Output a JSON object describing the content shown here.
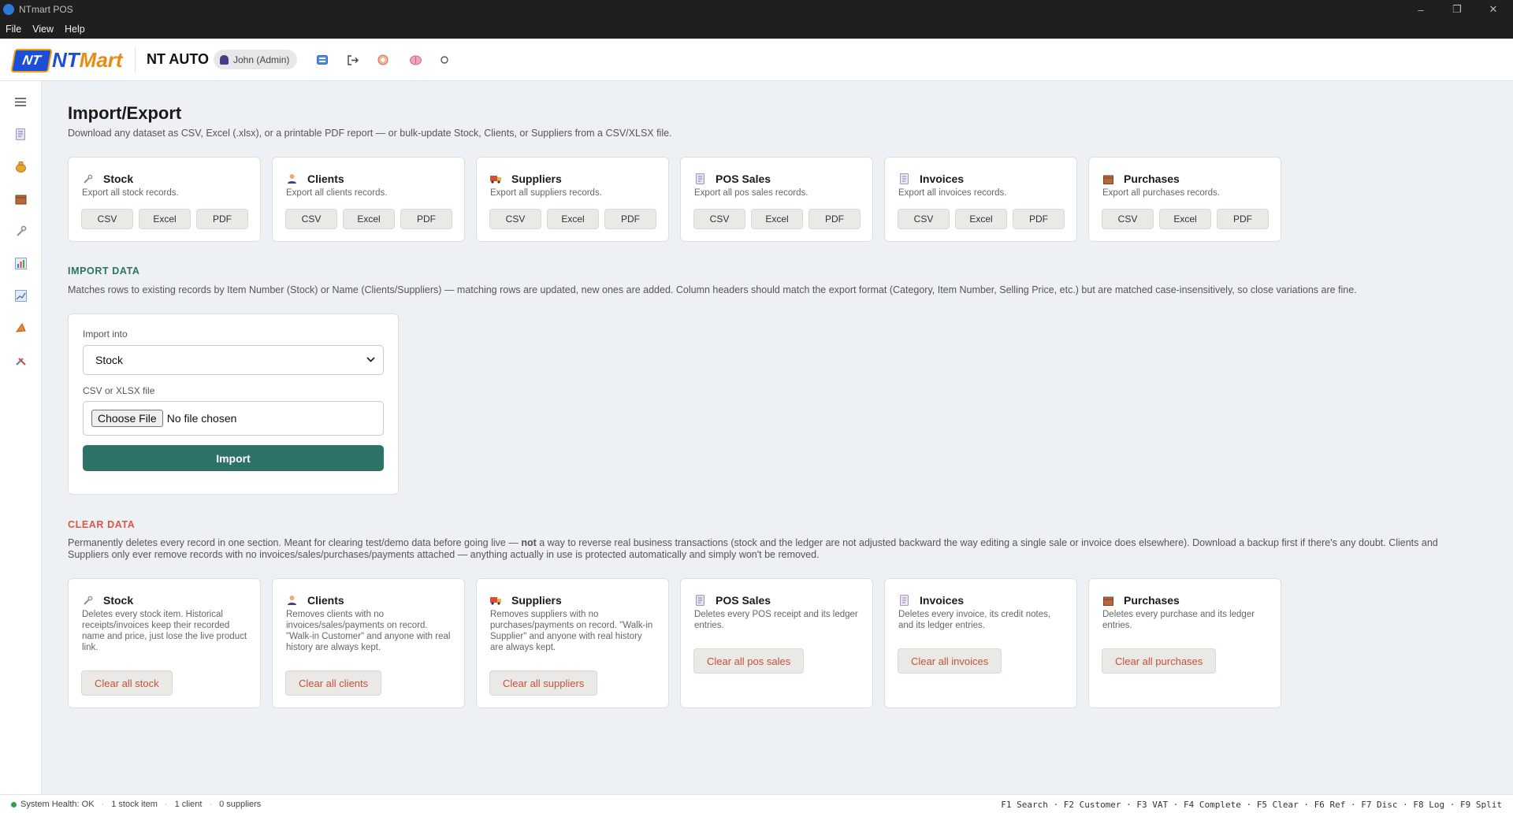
{
  "window": {
    "title": "NTmart POS",
    "minimize": "–",
    "maximize": "❐",
    "close": "✕"
  },
  "menu": {
    "file": "File",
    "view": "View",
    "help": "Help"
  },
  "header": {
    "logo_badge": "NT",
    "logo_nt": "NT",
    "logo_mart": "Mart",
    "store_name": "NT AUTO",
    "user": "John (Admin)"
  },
  "page": {
    "title": "Import/Export",
    "subtitle": "Download any dataset as CSV, Excel (.xlsx), or a printable PDF report — or bulk-update Stock, Clients, or Suppliers from a CSV/XLSX file."
  },
  "export_cards": [
    {
      "title": "Stock",
      "desc": "Export all stock records.",
      "icon": "wrench-icon"
    },
    {
      "title": "Clients",
      "desc": "Export all clients records.",
      "icon": "person-icon"
    },
    {
      "title": "Suppliers",
      "desc": "Export all suppliers records.",
      "icon": "truck-icon"
    },
    {
      "title": "POS Sales",
      "desc": "Export all pos sales records.",
      "icon": "receipt-icon"
    },
    {
      "title": "Invoices",
      "desc": "Export all invoices records.",
      "icon": "document-icon"
    },
    {
      "title": "Purchases",
      "desc": "Export all purchases records.",
      "icon": "box-icon"
    }
  ],
  "export_buttons": {
    "csv": "CSV",
    "excel": "Excel",
    "pdf": "PDF"
  },
  "import": {
    "heading": "IMPORT DATA",
    "description": "Matches rows to existing records by Item Number (Stock) or Name (Clients/Suppliers) — matching rows are updated, new ones are added. Column headers should match the export format (Category, Item Number, Selling Price, etc.) but are matched case-insensitively, so close variations are fine.",
    "into_label": "Import into",
    "into_value": "Stock",
    "file_label": "CSV or XLSX file",
    "choose_label": "Choose File",
    "file_status": "No file chosen",
    "button": "Import"
  },
  "clear": {
    "heading": "CLEAR DATA",
    "description_a": "Permanently deletes every record in one section. Meant for clearing test/demo data before going live — ",
    "description_bold": "not",
    "description_b": " a way to reverse real business transactions (stock and the ledger are not adjusted backward the way editing a single sale or invoice does elsewhere). Download a backup first if there's any doubt. Clients and Suppliers only ever remove records with no invoices/sales/purchases/payments attached — anything actually in use is protected automatically and simply won't be removed.",
    "cards": [
      {
        "title": "Stock",
        "desc": "Deletes every stock item. Historical receipts/invoices keep their recorded name and price, just lose the live product link.",
        "button": "Clear all stock"
      },
      {
        "title": "Clients",
        "desc": "Removes clients with no invoices/sales/payments on record. \"Walk-in Customer\" and anyone with real history are always kept.",
        "button": "Clear all clients"
      },
      {
        "title": "Suppliers",
        "desc": "Removes suppliers with no purchases/payments on record. \"Walk-in Supplier\" and anyone with real history are always kept.",
        "button": "Clear all suppliers"
      },
      {
        "title": "POS Sales",
        "desc": "Deletes every POS receipt and its ledger entries.",
        "button": "Clear all pos sales"
      },
      {
        "title": "Invoices",
        "desc": "Deletes every invoice, its credit notes, and its ledger entries.",
        "button": "Clear all invoices"
      },
      {
        "title": "Purchases",
        "desc": "Deletes every purchase and its ledger entries.",
        "button": "Clear all purchases"
      }
    ]
  },
  "status": {
    "health": "System Health: OK",
    "stock": "1 stock item",
    "clients": "1 client",
    "suppliers": "0 suppliers",
    "shortcuts": "F1 Search · F2 Customer · F3 VAT · F4 Complete · F5 Clear · F6 Ref · F7 Disc · F8 Log · F9 Split"
  },
  "colors": {
    "accent_teal": "#2d7268",
    "import_heading": "#2d7268",
    "clear_heading": "#d9574a",
    "danger_text": "#c0533a",
    "health_ok": "#2fa24a"
  }
}
